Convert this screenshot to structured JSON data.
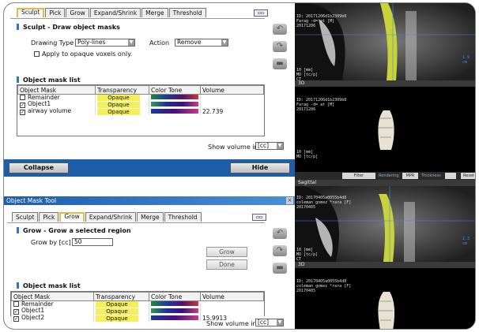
{
  "sculpt_panel": {
    "tabs": [
      "Sculpt",
      "Pick",
      "Grow",
      "Expand/Shrink",
      "Merge",
      "Threshold"
    ],
    "active_tab": "Sculpt",
    "section_title": "Sculpt - Draw object masks",
    "drawing_type_label": "Drawing Type",
    "drawing_type_value": "Poly-lines",
    "action_label": "Action",
    "action_value": "Remove",
    "apply_opaque_label": "Apply to opaque voxels only.",
    "mask_list_title": "Object mask list",
    "columns": [
      "Object Mask",
      "Transparency",
      "Color Tone",
      "Volume"
    ],
    "rows": [
      {
        "name": "Remainder",
        "checked": false,
        "transparency": "Opaque",
        "volume": ""
      },
      {
        "name": "Object1",
        "checked": true,
        "transparency": "Opaque",
        "volume": ""
      },
      {
        "name": "airway volume",
        "checked": true,
        "transparency": "Opaque",
        "volume": "22.739"
      }
    ],
    "show_volume_label": "Show volume in",
    "show_volume_unit": "[cc]",
    "collapse_label": "Collapse",
    "hide_label": "Hide"
  },
  "grow_panel": {
    "window_title": "Object Mask Tool",
    "tabs": [
      "Sculpt",
      "Pick",
      "Grow",
      "Expand/Shrink",
      "Merge",
      "Threshold"
    ],
    "active_tab": "Grow",
    "section_title": "Grow - Grow a selected region",
    "grow_by_label": "Grow by [cc]",
    "grow_by_value": "50",
    "grow_button": "Grow",
    "done_button": "Done",
    "mask_list_title": "Object mask list",
    "columns": [
      "Object Mask",
      "Transparency",
      "Color Tone",
      "Volume"
    ],
    "rows": [
      {
        "name": "Remainder",
        "checked": false,
        "transparency": "Opaque",
        "volume": ""
      },
      {
        "name": "Object1",
        "checked": true,
        "transparency": "Opaque",
        "volume": ""
      },
      {
        "name": "Object2",
        "checked": true,
        "transparency": "Opaque",
        "volume": "15.9913"
      }
    ],
    "show_volume_label": "Show volume in",
    "show_volume_unit": "[cc]"
  },
  "viewer": {
    "view_3d_label": "3D",
    "sagittal_label": "Sagittal",
    "filter_label": "Filter",
    "rendering_label": "Rendering",
    "rendering_value": "MPR",
    "thickness_label": "Thickness",
    "reset_label": "Reset",
    "overlay_top_1": "ID: 20171206d1b2309b8",
    "overlay_top_2": "Farag -d= at [M]",
    "overlay_top_3": "20171206",
    "overlay_3d_1": "ID: 20171206d1b2309b8",
    "overlay_3d_2": "Farag -d= at [M]",
    "overlay_3d_3": "20171206",
    "overlay_sag_1": "ID: 20170405a0055b4d8",
    "overlay_sag_2": "coleman gomez *rara [F]",
    "overlay_sag_3": "20170405",
    "overlay_3d2_1": "ID: 20170405a0055b4d8",
    "overlay_3d2_2": "coleman gomez *rara [F]",
    "overlay_3d2_3": "20170405",
    "wl_1": "10 [mm]",
    "wl_2": "MO [tc/p]",
    "wl_3": "CT",
    "scale_1": "1.9 cm",
    "scale_2": "2.3 cm"
  }
}
